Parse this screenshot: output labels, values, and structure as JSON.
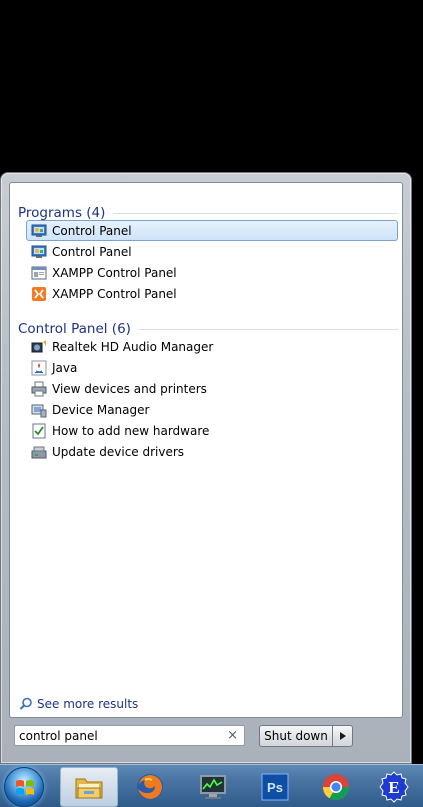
{
  "programs": {
    "header": "Programs (4)",
    "items": [
      {
        "label": "Control Panel",
        "icon": "control-panel-icon",
        "selected": true
      },
      {
        "label": "Control Panel",
        "icon": "control-panel-icon",
        "selected": false
      },
      {
        "label": "XAMPP Control Panel",
        "icon": "xampp-window-icon",
        "selected": false
      },
      {
        "label": "XAMPP Control Panel",
        "icon": "xampp-icon",
        "selected": false
      }
    ]
  },
  "control_panel": {
    "header": "Control Panel (6)",
    "items": [
      {
        "label": "Realtek HD Audio Manager",
        "icon": "speaker-icon"
      },
      {
        "label": "Java",
        "icon": "java-icon"
      },
      {
        "label": "View devices and printers",
        "icon": "printer-icon"
      },
      {
        "label": "Device Manager",
        "icon": "device-manager-icon"
      },
      {
        "label": "How to add new hardware",
        "icon": "hardware-checklist-icon"
      },
      {
        "label": "Update device drivers",
        "icon": "drivers-icon"
      }
    ]
  },
  "see_more": {
    "label": "See more results"
  },
  "search": {
    "value": "control panel",
    "clear_glyph": "×"
  },
  "power": {
    "label": "Shut down",
    "arrow_glyph": "▶"
  },
  "taskbar": {
    "items": [
      {
        "name": "explorer",
        "icon": "folder-icon",
        "active": true
      },
      {
        "name": "firefox",
        "icon": "firefox-icon",
        "active": false
      },
      {
        "name": "task-manager",
        "icon": "monitor-icon",
        "active": false
      },
      {
        "name": "photoshop",
        "icon": "photoshop-icon",
        "label": "Ps",
        "active": false
      },
      {
        "name": "chrome",
        "icon": "chrome-icon",
        "active": false
      },
      {
        "name": "app-e",
        "icon": "e-app-icon",
        "label": "E",
        "active": false
      }
    ]
  }
}
